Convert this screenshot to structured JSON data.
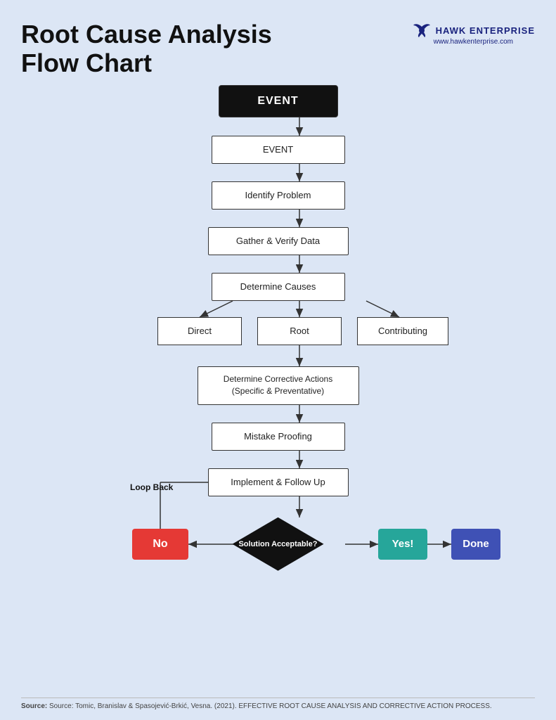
{
  "page": {
    "title_line1": "Root Cause Analysis",
    "title_line2": "Flow Chart",
    "brand": {
      "name": "HAWK ENTERPRISE",
      "url": "www.hawkenterprise.com"
    },
    "flowchart": {
      "event_top": "EVENT",
      "node_event": "EVENT",
      "node_identify": "Identify Problem",
      "node_gather": "Gather & Verify Data",
      "node_determine": "Determine Causes",
      "node_direct": "Direct",
      "node_root": "Root",
      "node_contributing": "Contributing",
      "node_corrective": "Determine Corrective Actions\n(Specific & Preventative)",
      "node_mistake": "Mistake Proofing",
      "node_implement": "Implement & Follow Up",
      "node_solution": "Solution\nAcceptable?",
      "node_no": "No",
      "node_yes": "Yes!",
      "node_done": "Done",
      "loop_back": "Loop\nBack"
    },
    "footer": "Source: Tomic, Branislav & Spasojević-Brkić, Vesna. (2021). EFFECTIVE ROOT CAUSE ANALYSIS AND CORRECTIVE ACTION PROCESS."
  }
}
